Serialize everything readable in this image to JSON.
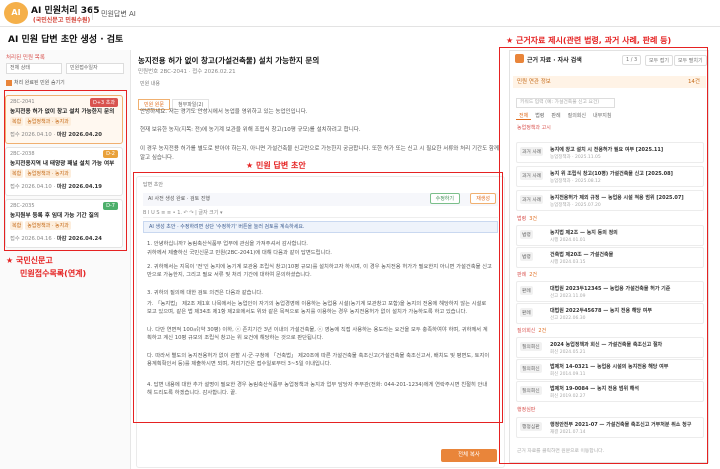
{
  "app": {
    "logo_text": "AI",
    "brand": "AI 민원처리 365",
    "brand_sub": "(국민신문고 민원수원)",
    "nav": "민원답변 AI"
  },
  "page": {
    "title": "AI 민원 답변 초안 생성 · 검토"
  },
  "left": {
    "filter_label": "처리된 민원 목록",
    "sel1": "전체 상태",
    "sel2": "민원접수일자",
    "checkbox": "처리 완료된 민원 숨기기",
    "cards": [
      {
        "id": "2BC-2041",
        "badge": "D+3 초과",
        "title": "농지전용 허가 없이 창고 설치 가능한지 문의",
        "tag1": "복합",
        "tag2": "농업정책과 · 농지과",
        "meta_prefix": "접수 2026.04.10 · ",
        "deadline": "마감 2026.04.20"
      },
      {
        "id": "2BC-2038",
        "badge": "D-2",
        "title": "농지전용지역 내 태양광 패널 설치 가능 여부",
        "tag1": "복합",
        "tag2": "농업정책과 · 농지과",
        "meta_prefix": "접수 2026.04.10 · ",
        "deadline": "마감 2026.04.19"
      },
      {
        "id": "2BC-2035",
        "badge": "D-7",
        "title": "농지원부 등록 후 임대 가능 기간 질의",
        "tag1": "복합",
        "tag2": "농업정책과 · 농지과",
        "meta_prefix": "접수 2026.04.16 · ",
        "deadline": "마감 2026.04.24"
      }
    ]
  },
  "mid": {
    "title": "농지전용 허가 없이 창고(가설건축물) 설치 가능한지 문의",
    "meta": "민원번호 2BC-2041 · 접수 2026.02.21",
    "sec_label": "민원 내용",
    "tab1": "민원 원문",
    "tab2": "첨부파일(2)",
    "p1": "안녕하세요. 저는 경기도 안성시에서 농업을 영위하고 있는 농업인입니다.",
    "p2": "현재 보유한 농지(지목: 전)에 농기계 보관을 위해 조립식 창고(10평 규모)를 설치하려고 합니다.",
    "p3": "이 경우 농지전용 허가를 별도로 받아야 하는지, 아니면 가설건축물 신고만으로 가능한지 궁금합니다. 또한 허가 또는 신고 시 필요한 서류와 처리 기간도 함께 알고 싶습니다.",
    "draft_label": "답변 초안",
    "draft_info": "AI 사전 생성 완료 · 검토 진행",
    "btn_edit": "수정하기",
    "btn_regen": "재생성",
    "toolbar": "B  I  U  S   ≡  ≡   •  1.   ↶  ↷   |   글자 크기  ▾",
    "notice": "AI 생성 초안 · 수정하려면 상단 '수정하기' 버튼을 눌러 검토를 계속하세요.",
    "d1": "1. 안녕하십니까? 농림축산식품부 업무에 관심을 가져주셔서 감사합니다.",
    "d2": "귀하께서 제출하신 국민신문고 민원(2BC-2041)에 대해 다음과 같이 답변드립니다.",
    "d3": "2. 귀하께서는 지목이 '전'인 농지에 농기계 보관용 조립식 창고(10평 규모)를 설치하고자 하시며, 이 경우 농지전용 허가가 필요한지 아니면 가설건축물 신고만으로 가능한지, 그리고 필요 서류 및 처리 기간에 대하여 문의하셨습니다.",
    "d4": "3. 귀하의 질의에 대한 검토 의견은 다음과 같습니다.",
    "d5": "가. 「농지법」 제2조 제1호 나목에서는 농업인이 자기의 농업경영에 이용하는 농업용 시설(농기계 보관창고 포함)을 농지의 전용에 해당하지 않는 시설로 보고 있으며, 같은 법 제34조 제1항 제2호에서도 위와 같은 목적으로 농지를 이용하는 경우 농지전용허가 없이 설치가 가능하도록 하고 있습니다.",
    "d6": "나. 다만 연면적 100㎡(약 30평) 이하, ⓒ 존치기간 3년 이내의 가설건축물, ⓒ 영농에 직접 사용하는 용도라는 요건을 모두 충족하여야 하며, 귀하께서 계획하고 계신 10평 규모의 조립식 창고는 위 요건에 해당하는 것으로 판단됩니다.",
    "d7": "다. 따라서 별도의 농지전용허가 없이 관할 시·군·구청에 「건축법」 제20조에 따른 가설건축물 축조신고(가설건축물 축조신고서, 배치도 및 평면도, 토지이용계획확인서 등)를 제출하시면 되며, 처리기간은 접수일로부터 3~5일 이내입니다.",
    "d8": "4. 답변 내용에 대한 추가 설명이 필요한 경우 농림축산식품부 농업정책과 농지과 업무 담당자 주무관(전화: 044-201-1234)에게 연락주시면 친절히 안내해 드리도록 하겠습니다. 감사합니다. 끝.",
    "copy": "전체 복사"
  },
  "right": {
    "head": "근거 자료 · 자사 검색",
    "pager": "1 / 3",
    "btn1": "모두 접기",
    "btn2": "모두 펼치기",
    "sec": "민원 연관 정보",
    "sec_count": "14건",
    "search_ph": "키워드 입력 (예: 가설건축물 신고 요건)",
    "tabs": [
      "전체",
      "법령",
      "판례",
      "질의회신",
      "내부지침"
    ],
    "g1": "농업정책과 고시",
    "g1c": "",
    "g2": "법령",
    "g2c": "3건",
    "g3": "판례",
    "g3c": "2건",
    "g4": "질의회신",
    "g4c": "2건",
    "g5": "행정심판",
    "g5c": "",
    "items": [
      {
        "t": "과거 사례",
        "n": "농지에 창고 설치 시 전용허가 필요 여부 [2025.11]",
        "d": "농업정책과 · 2025.11.05"
      },
      {
        "t": "과거 사례",
        "n": "농지 위 조립식 창고(10평) 가설건축물 신고 [2025.08]",
        "d": "농업정책과 · 2025.08.12"
      },
      {
        "t": "과거 사례",
        "n": "농지전용허가 제외 규정 — 농업용 시설 적용 범위 [2025.07]",
        "d": "농업정책과 · 2025.07.20"
      },
      {
        "t": "법령",
        "n": "농지법 제2조 — 농지 등의 정의",
        "d": "시행 2024.01.01"
      },
      {
        "t": "법령",
        "n": "건축법 제20조 — 가설건축물",
        "d": "시행 2024.03.15"
      },
      {
        "t": "판례",
        "n": "대법원 2023두12345 — 농업용 가설건축물 허가 기준",
        "d": "선고 2023.11.09"
      },
      {
        "t": "판례",
        "n": "대법원 2022두45678 — 농지 전용 해당 여부",
        "d": "선고 2022.06.30"
      },
      {
        "t": "질의회신",
        "n": "2024 농업정책과 회신 — 가설건축물 축조신고 절차",
        "d": "회신 2024.05.21"
      },
      {
        "t": "질의회신",
        "n": "법제처 14-0321 — 농업용 시설의 농지전용 해당 여부",
        "d": "회신 2014.09.11"
      },
      {
        "t": "질의회신",
        "n": "법제처 19-0084 — 농지 전용 범위 해석",
        "d": "회신 2019.02.27"
      },
      {
        "t": "행정심판",
        "n": "행정안전부 2021-07 — 가설건축물 축조신고 거부처분 취소 청구",
        "d": "재결 2021.07.14"
      }
    ],
    "footer": "근거 자료를 클릭하면 원문으로 이동합니다."
  },
  "annotations": {
    "a1": "★ 근거자료 제시(관련 법령, 과거 사례, 판례 등)",
    "a2": "★ 민원 답변 초안",
    "a3": "★ 국민신문고",
    "a4": "민원접수목록(연계)"
  },
  "colors": {
    "accent": "#e9853a",
    "annotation": "#e52222"
  }
}
